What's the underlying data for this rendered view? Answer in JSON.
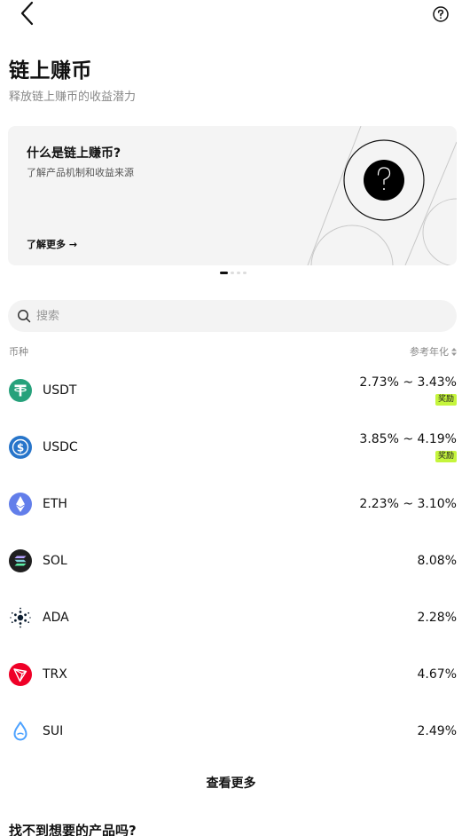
{
  "page": {
    "title": "链上赚币",
    "subtitle": "释放链上赚币的收益潜力"
  },
  "banner": {
    "title": "什么是链上赚币?",
    "description": "了解产品机制和收益来源",
    "link": "了解更多 →",
    "icon": "question-circle-icon"
  },
  "carousel": {
    "total": 4,
    "active": 1
  },
  "search": {
    "placeholder": "搜索",
    "value": ""
  },
  "list_header": {
    "coin": "币种",
    "apy": "参考年化"
  },
  "coins": [
    {
      "symbol": "USDT",
      "rate": "2.73% ~ 3.43%",
      "badge": "奖励",
      "icon": "usdt-icon",
      "color": "#26a17b"
    },
    {
      "symbol": "USDC",
      "rate": "3.85% ~ 4.19%",
      "badge": "奖励",
      "icon": "usdc-icon",
      "color": "#2775ca"
    },
    {
      "symbol": "ETH",
      "rate": "2.23% ~ 3.10%",
      "badge": "",
      "icon": "eth-icon",
      "color": "#627eea"
    },
    {
      "symbol": "SOL",
      "rate": "8.08%",
      "badge": "",
      "icon": "sol-icon",
      "color": "#1f1f1f"
    },
    {
      "symbol": "ADA",
      "rate": "2.28%",
      "badge": "",
      "icon": "ada-icon",
      "color": "#0d1e30"
    },
    {
      "symbol": "TRX",
      "rate": "4.67%",
      "badge": "",
      "icon": "trx-icon",
      "color": "#ef0027"
    },
    {
      "symbol": "SUI",
      "rate": "2.49%",
      "badge": "",
      "icon": "sui-icon",
      "color": "#4da2ff"
    }
  ],
  "more_button": "查看更多",
  "bottom_title": "找不到想要的产品吗?",
  "colors": {
    "reward_badge": "#c5f53c",
    "banner_bg": "#f4f4f4",
    "search_bg": "#f3f3f3"
  }
}
